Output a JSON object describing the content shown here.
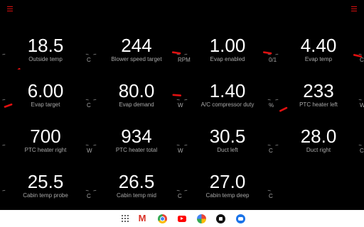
{
  "colors": {
    "background": "#000000",
    "value": "#ffffff",
    "label": "#a8a8a8",
    "tick": "#8a8a8a",
    "needle": "#e01010",
    "navbar": "#ffffff"
  },
  "menus": [
    {
      "icon": "menu-icon"
    },
    {
      "icon": "menu-icon"
    }
  ],
  "gauges": [
    {
      "value": "18.5",
      "label": "Outside temp",
      "unit": "C",
      "needle_angle": 135
    },
    {
      "value": "244",
      "label": "Blower speed target",
      "unit": "RPM",
      "needle_angle": 10
    },
    {
      "value": "1.00",
      "label": "Evap enabled",
      "unit": "0/1",
      "needle_angle": 10
    },
    {
      "value": "4.40",
      "label": "Evap temp",
      "unit": "C",
      "needle_angle": 15
    },
    {
      "value": "6.00",
      "label": "Evap target",
      "unit": "C",
      "needle_angle": 157
    },
    {
      "value": "80.0",
      "label": "Evap demand",
      "unit": "W",
      "needle_angle": 5
    },
    {
      "value": "1.40",
      "label": "A/C compressor duty",
      "unit": "%",
      "needle_angle": 70
    },
    {
      "value": "233",
      "label": "PTC heater left",
      "unit": "W",
      "needle_angle": 150
    },
    {
      "value": "700",
      "label": "PTC heater right",
      "unit": "W",
      "needle_angle": 60
    },
    {
      "value": "934",
      "label": "PTC heater total",
      "unit": "W",
      "needle_angle": 60
    },
    {
      "value": "30.5",
      "label": "Duct left",
      "unit": "C",
      "needle_angle": 123
    },
    {
      "value": "28.0",
      "label": "Duct right",
      "unit": "C",
      "needle_angle": 123
    },
    {
      "value": "25.5",
      "label": "Cabin temp probe",
      "unit": "C",
      "needle_angle": 123
    },
    {
      "value": "26.5",
      "label": "Cabin temp mid",
      "unit": "C",
      "needle_angle": 123
    },
    {
      "value": "27.0",
      "label": "Cabin temp deep",
      "unit": "C",
      "needle_angle": 123
    }
  ],
  "navbar": {
    "apps": [
      {
        "name": "app-drawer"
      },
      {
        "name": "Gmail",
        "glyph": "M"
      },
      {
        "name": "Chrome"
      },
      {
        "name": "YouTube"
      },
      {
        "name": "Photos"
      },
      {
        "name": "App"
      },
      {
        "name": "Messages"
      }
    ]
  }
}
